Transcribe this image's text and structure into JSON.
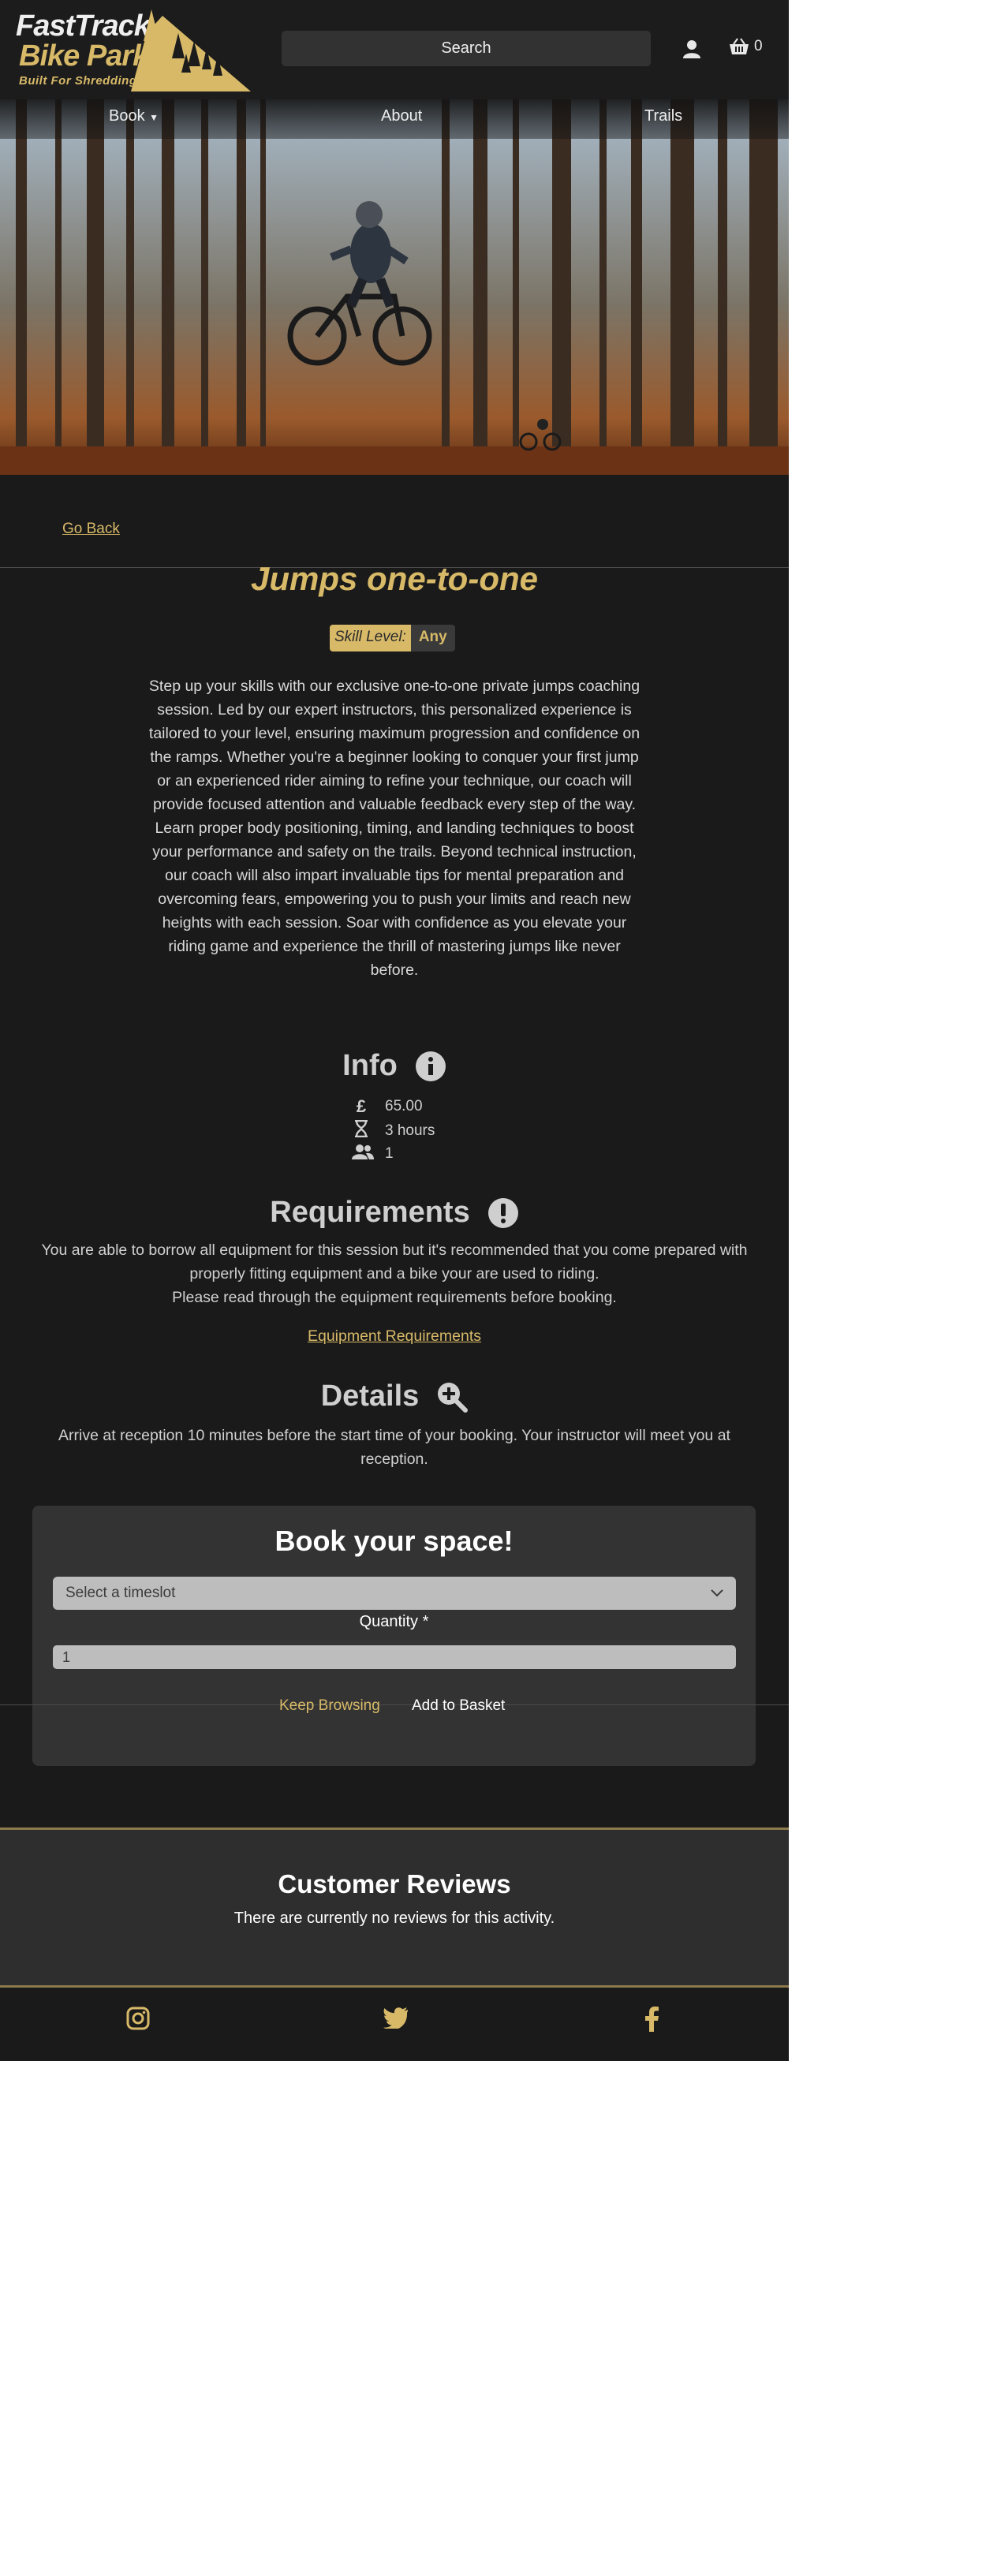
{
  "header": {
    "logo_line1": "FastTrack",
    "logo_line2": "Bike Park",
    "logo_tagline": "Built For Shredding",
    "search_label": "Search",
    "basket_count": "0"
  },
  "nav": {
    "book": "Book",
    "about": "About",
    "trails": "Trails"
  },
  "back_link": "Go Back",
  "activity": {
    "title": "Jumps one-to-one",
    "skill_label": "Skill Level:",
    "skill_value": "Any",
    "description": "Step up your skills with our exclusive one-to-one private jumps coaching session. Led by our expert instructors, this personalized experience is tailored to your level, ensuring maximum progression and confidence on the ramps. Whether you're a beginner looking to conquer your first jump or an experienced rider aiming to refine your technique, our coach will provide focused attention and valuable feedback every step of the way. Learn proper body positioning, timing, and landing techniques to boost your performance and safety on the trails. Beyond technical instruction, our coach will also impart invaluable tips for mental preparation and overcoming fears, empowering you to push your limits and reach new heights with each session. Soar with confidence as you elevate your riding game and experience the thrill of mastering jumps like never before."
  },
  "info": {
    "title": "Info",
    "price": "65.00",
    "duration": "3 hours",
    "participants": "1"
  },
  "requirements": {
    "title": "Requirements",
    "text": "You are able to borrow all equipment for this session but it's recommended that you come prepared with properly fitting equipment and a bike your are used to riding.",
    "text2": "Please read through the equipment requirements before booking.",
    "link": "Equipment Requirements"
  },
  "details": {
    "title": "Details",
    "text": "Arrive at reception 10 minutes before the start time of your booking. Your instructor will meet you at reception."
  },
  "booking": {
    "title": "Book your space!",
    "timeslot_placeholder": "Select a timeslot",
    "quantity_label": "Quantity *",
    "quantity_value": "1",
    "keep_browsing": "Keep Browsing",
    "add_to_basket": "Add to Basket"
  },
  "reviews": {
    "title": "Customer Reviews",
    "empty_text": "There are currently no reviews for this activity."
  },
  "footer": {
    "icons": [
      "instagram-icon",
      "twitter-icon",
      "facebook-icon"
    ]
  },
  "colors": {
    "accent": "#d7b968",
    "background": "#1a1a1a",
    "panel": "#333333"
  }
}
